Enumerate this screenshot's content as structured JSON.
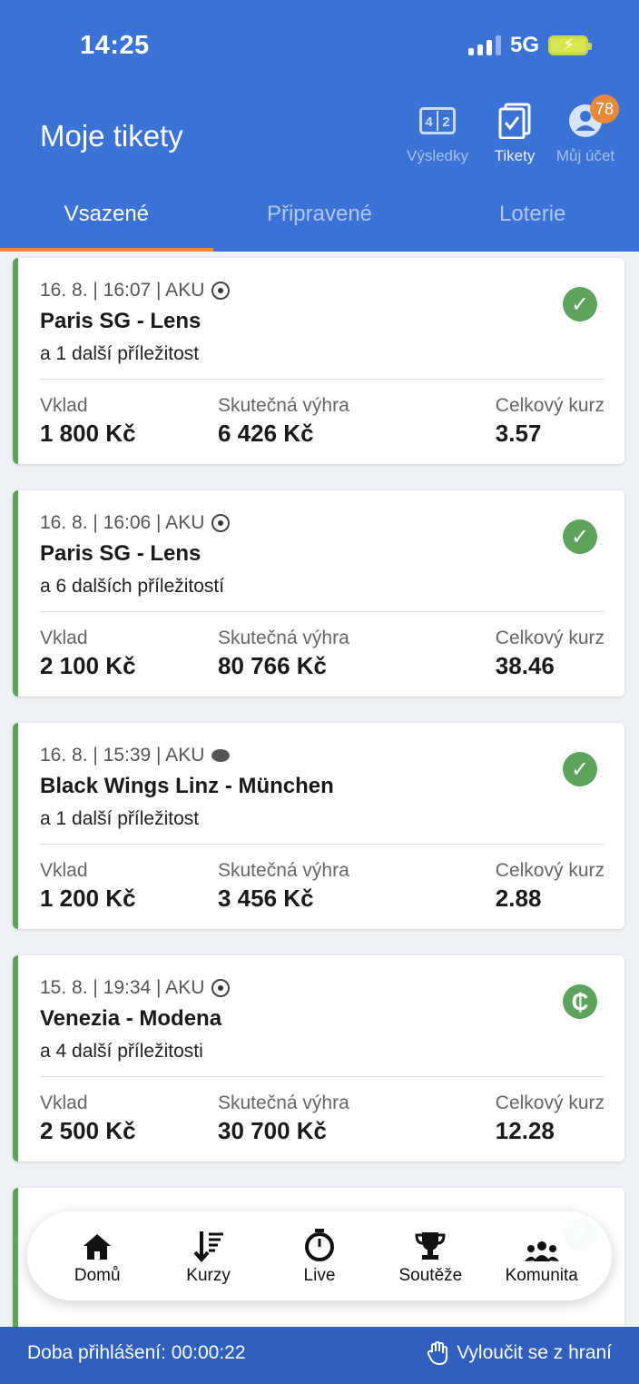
{
  "status_bar": {
    "time": "14:25",
    "network": "5G"
  },
  "header": {
    "title": "Moje tikety",
    "icons": [
      {
        "label": "Výsledky",
        "icon": "scoreboard-icon",
        "score": "4 2"
      },
      {
        "label": "Tikety",
        "icon": "ticket-check-icon"
      },
      {
        "label": "Můj účet",
        "icon": "user-icon",
        "badge": "78"
      }
    ]
  },
  "tabs": [
    {
      "label": "Vsazené",
      "active": true
    },
    {
      "label": "Připravené",
      "active": false
    },
    {
      "label": "Loterie",
      "active": false
    }
  ],
  "labels": {
    "stake": "Vklad",
    "win": "Skutečná výhra",
    "odds": "Celkový kurz"
  },
  "tickets": [
    {
      "meta": "16. 8. | 16:07 | AKU",
      "sport": "football-icon",
      "title": "Paris SG - Lens",
      "sub": "a 1 další příležitost",
      "status": "won-check-icon",
      "stake": "1 800 Kč",
      "win": "6 426 Kč",
      "odds": "3.57"
    },
    {
      "meta": "16. 8. | 16:06 | AKU",
      "sport": "football-icon",
      "title": "Paris SG - Lens",
      "sub": "a 6 dalších příležitostí",
      "status": "won-check-icon",
      "stake": "2 100 Kč",
      "win": "80 766 Kč",
      "odds": "38.46"
    },
    {
      "meta": "16. 8. | 15:39 | AKU",
      "sport": "hockey-puck-icon",
      "title": "Black Wings Linz - München",
      "sub": "a 1 další příležitost",
      "status": "won-check-icon",
      "stake": "1 200 Kč",
      "win": "3 456 Kč",
      "odds": "2.88"
    },
    {
      "meta": "15. 8. | 19:34 | AKU",
      "sport": "football-icon",
      "title": "Venezia - Modena",
      "sub": "a 4 další příležitosti",
      "status": "cashout-icon",
      "stake": "2 500 Kč",
      "win": "30 700 Kč",
      "odds": "12.28"
    }
  ],
  "bottom_nav": [
    {
      "label": "Domů",
      "icon": "home-icon"
    },
    {
      "label": "Kurzy",
      "icon": "odds-sort-icon"
    },
    {
      "label": "Live",
      "icon": "stopwatch-icon"
    },
    {
      "label": "Soutěže",
      "icon": "trophy-icon"
    },
    {
      "label": "Komunita",
      "icon": "community-icon"
    }
  ],
  "footer": {
    "session": "Doba přihlášení: 00:00:22",
    "exclude": "Vyloučit se z hraní"
  }
}
